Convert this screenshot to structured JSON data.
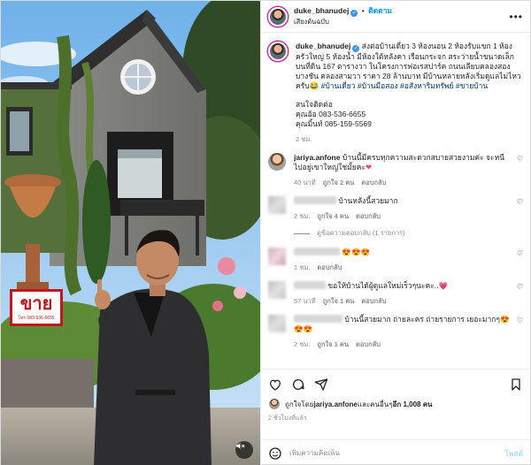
{
  "header": {
    "username": "duke_bhanudej",
    "verified_icon": "verified-badge-icon",
    "separator": "•",
    "follow_label": "ติดตาม",
    "audio_label": "เสียงต้นฉบับ",
    "more_icon": "more-options-icon"
  },
  "media": {
    "sign_text": "ขาย",
    "sign_subtext": "โทร 083-536-6655",
    "mute_icon": "speaker-muted-icon"
  },
  "caption": {
    "username": "duke_bhanudej",
    "text": "ส่งต่อบ้านเดี่ยว 3 ห้องนอน 2 ห้องรับแขก 1 ห้องครัวใหญ่ 5 ห้องน้ำ มีห้องใต้หลังคา เรือนกระจก สระว่ายน้ำขนาดเล็ก บนที่ดิน 167 ตารางวา ในโครงการฟอเรสปาร์ค ถนนเลียบคลองสอง บางชัน คลองสามวา ราคา 28 ล้านบาท มีบ้านหลายหลังเริ่มดูแลไม่ไหวครับ😂 ",
    "hashtags": "#บ้านเดี่ยว #บ้านมือสอง #อสังหาริมทรัพย์ #ขายบ้าน",
    "contact_title": "สนใจติดต่อ",
    "contact_1": "คุณอ้อ 083-536-6655",
    "contact_2": "คุณมิ้นท์ 085-159-5569",
    "time": "2 ชม."
  },
  "comments": [
    {
      "username": "jariya.anfone",
      "text": "บ้านนี้มีครบทุกความสะดวกสบายสวยงามค่ะ จะหนีไปอยู่เขาใหญ่ใช่มั้ยคะ",
      "emoji": "❤",
      "time": "40 นาที",
      "likes": "ถูกใจ 2 คน",
      "reply": "ตอบกลับ"
    },
    {
      "username": "",
      "text": "บ้านหลังนี้สวยมาก",
      "emoji": "",
      "time": "2 ชม.",
      "likes": "ถูกใจ 4 คน",
      "reply": "ตอบกลับ"
    },
    {
      "username": "",
      "text": "",
      "emoji": "😍😍😍",
      "time": "1 ชม.",
      "likes": "",
      "reply": "ตอบกลับ"
    },
    {
      "username": "",
      "text": "ขอให้บ้านได้ผู้ดูแลใหม่เร็วๆนะคะ..",
      "emoji": "💗",
      "time": "57 นาที",
      "likes": "ถูกใจ 1 คน",
      "reply": "ตอบกลับ"
    },
    {
      "username": "",
      "text": "บ้านนี้สวยมาก ถ่ายละคร ถ่ายรายการ เยอะมากๆ",
      "emoji": "😍😍😍",
      "time": "2 ชม.",
      "likes": "ถูกใจ 1 คน",
      "reply": "ตอบกลับ"
    }
  ],
  "view_replies": "ดูข้อความตอบกลับ (1 รายการ)",
  "actions": {
    "like_icon": "heart-icon",
    "comment_icon": "comment-icon",
    "share_icon": "share-icon",
    "save_icon": "bookmark-icon",
    "liked_by_prefix": "ถูกใจโดย ",
    "liked_by_user": "jariya.anfone",
    "liked_by_mid": " และคนอื่นๆ ",
    "liked_by_count": "อีก 1,008 คน",
    "post_time": "2 ชั่วโมงที่แล้ว"
  },
  "comment_box": {
    "emoji_icon": "smiley-icon",
    "placeholder": "เพิ่มความคิดเห็น",
    "post_label": "โพสต์"
  },
  "colors": {
    "accent_blue": "#0095f6",
    "link_blue": "#00376b",
    "muted_gray": "#8e8e8e",
    "sign_red": "#c4161c"
  }
}
